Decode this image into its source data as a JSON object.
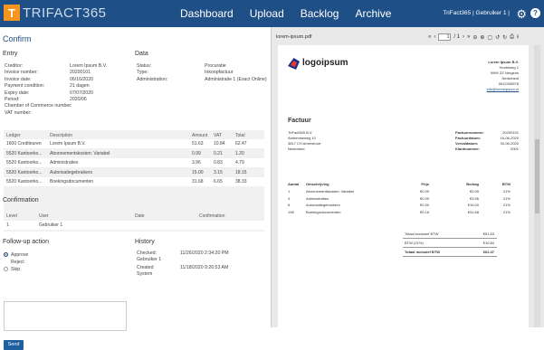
{
  "brand": "TRIFACT365",
  "brand_mark": "T",
  "nav": [
    "Dashboard",
    "Upload",
    "Backlog",
    "Archive"
  ],
  "user": "TriFact365 | Gebruiker 1 |",
  "page_title": "Confirm",
  "entry": {
    "heading": "Entry",
    "fields": [
      {
        "label": "Creditor:",
        "value": "Lorem Ipsum B.V."
      },
      {
        "label": "Invoice number:",
        "value": "20200101"
      },
      {
        "label": "Invoice date:",
        "value": "06/16/2020"
      },
      {
        "label": "Payment condition:",
        "value": "21 dagen"
      },
      {
        "label": "Expiry date:",
        "value": "07/07/2020"
      },
      {
        "label": "Period:",
        "value": "2020/06"
      },
      {
        "label": "Chamber of Commerce number:",
        "value": "."
      },
      {
        "label": "VAT number:",
        "value": ""
      }
    ]
  },
  "data": {
    "heading": "Data",
    "fields": [
      {
        "label": "Status:",
        "value": "Procuratie"
      },
      {
        "label": "Type:",
        "value": "Inkoopfactuur"
      },
      {
        "label": "Administration:",
        "value": "Administratie 1 (Exact Online)"
      }
    ]
  },
  "ledger_table": {
    "headers": [
      "Ledger",
      "Description",
      "Amount",
      "VAT",
      "Total"
    ],
    "rows": [
      [
        "1600 Crediteuren",
        "Lorem Ipsum B.V.",
        "51.63",
        "10.84",
        "62.47"
      ],
      [
        "5520 Kantoorko...",
        "Abonnementskosten: Variabel",
        "0.99",
        "0.21",
        "1.20"
      ],
      [
        "5520 Kantoorko...",
        "Administraties",
        "3.96",
        "0.83",
        "4.79"
      ],
      [
        "5520 Kantoorko...",
        "Autorisatiegebruikers",
        "15.00",
        "3.15",
        "18.15"
      ],
      [
        "5520 Kantoorko...",
        "Boekingsdocumenten",
        "31.68",
        "6.65",
        "38.33"
      ]
    ]
  },
  "confirmation": {
    "heading": "Confirmation",
    "headers": [
      "Level",
      "User",
      "Date",
      "Confirmation"
    ],
    "rows": [
      [
        "1",
        "Gebruiker 1",
        "",
        ""
      ]
    ]
  },
  "followup": {
    "heading": "Follow-up action",
    "options": [
      "Approve",
      "Reject",
      "Skip"
    ],
    "selected": "Approve",
    "send_label": "Send"
  },
  "history": {
    "heading": "History",
    "entries": [
      {
        "action": "Checked:",
        "user": "Gebruiker 1",
        "date": "11/26/2020 2:34:20 PM"
      },
      {
        "action": "Created",
        "user": "System",
        "date": "11/18/2020 9:26:53 AM"
      }
    ]
  },
  "pdf": {
    "filename": "lorem-ipsum.pdf",
    "page": "1",
    "pages": "/ 1",
    "logo": "logoipsum",
    "seller": [
      "Lorem Ipsum B.V.",
      "Hoofdweg 1",
      "9999 ZZ Nergens",
      "Nederland",
      "0612345678",
      "info@loremipsum.nl"
    ],
    "doc_title": "Factuur",
    "buyer": [
      "TriFact365 B.V.",
      "Amhemseweg 10",
      "3817 CH Amersfoort",
      "Nederland"
    ],
    "meta": [
      {
        "label": "Factuurnummer:",
        "value": "20200101"
      },
      {
        "label": "Factuurdatum:",
        "value": "16-06-2020"
      },
      {
        "label": "Vervaldatum:",
        "value": "30-06-2020"
      },
      {
        "label": "Klantnummer:",
        "value": "0001"
      }
    ],
    "lines_headers": [
      "Aantal",
      "Omschrijving",
      "Prijs",
      "Bedrag",
      "BTW"
    ],
    "lines": [
      [
        "1",
        "Abonnementskosten: Variabel",
        "€0.99",
        "€0.99",
        "21%"
      ],
      [
        "4",
        "Administraties",
        "€0.99",
        "€3.96",
        "21%"
      ],
      [
        "6",
        "Autorisatiegebruikers",
        "€2.50",
        "€15.00",
        "21%"
      ],
      [
        "198",
        "Boekingsdocumenten",
        "€0.16",
        "€31.68",
        "21%"
      ]
    ],
    "totals": [
      {
        "label": "Totaal exclusief BTW",
        "value": "€51.63"
      },
      {
        "label": "BTW (21%)",
        "value": "€10.84"
      },
      {
        "label": "Totaal inclusief BTW",
        "value": "€62.47"
      }
    ]
  }
}
